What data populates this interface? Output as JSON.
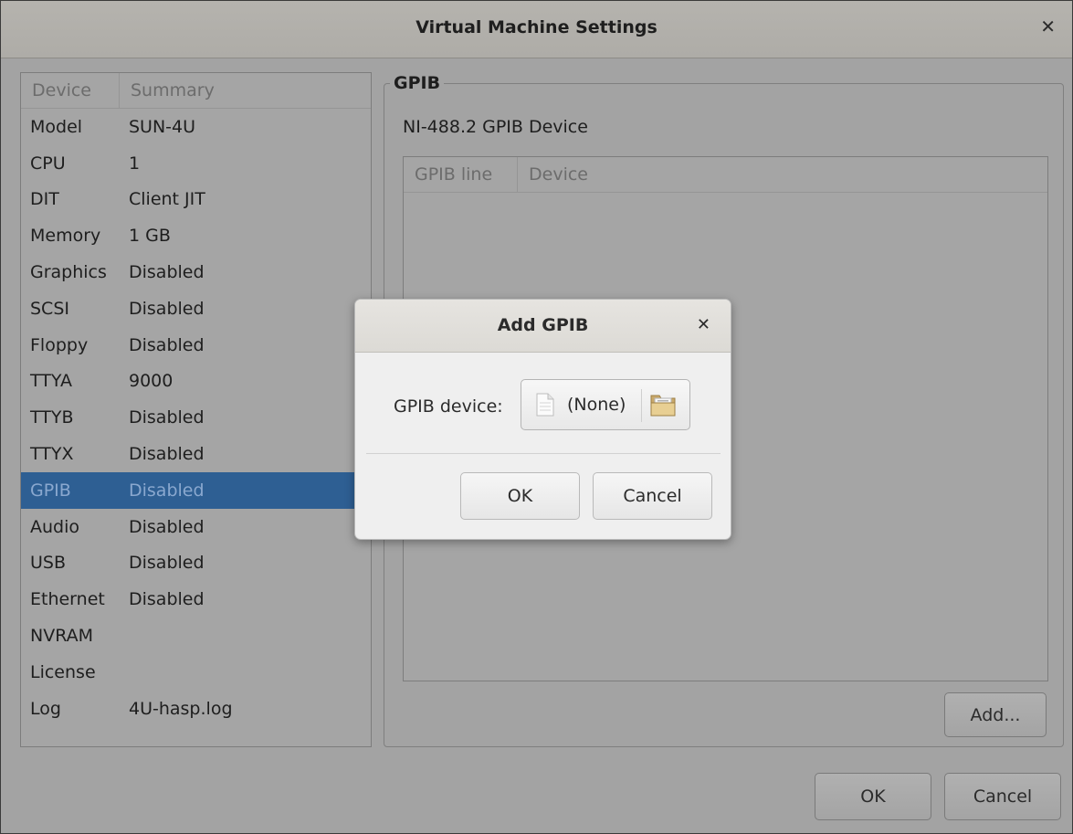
{
  "window": {
    "title": "Virtual Machine Settings"
  },
  "device_list": {
    "headers": {
      "device": "Device",
      "summary": "Summary"
    },
    "rows": [
      {
        "device": "Model",
        "summary": "SUN-4U"
      },
      {
        "device": "CPU",
        "summary": "1"
      },
      {
        "device": "DIT",
        "summary": "Client JIT"
      },
      {
        "device": "Memory",
        "summary": "1 GB"
      },
      {
        "device": "Graphics",
        "summary": "Disabled"
      },
      {
        "device": "SCSI",
        "summary": "Disabled"
      },
      {
        "device": "Floppy",
        "summary": "Disabled"
      },
      {
        "device": "TTYA",
        "summary": "9000"
      },
      {
        "device": "TTYB",
        "summary": "Disabled"
      },
      {
        "device": "TTYX",
        "summary": "Disabled"
      },
      {
        "device": "GPIB",
        "summary": "Disabled",
        "selected": true
      },
      {
        "device": "Audio",
        "summary": "Disabled"
      },
      {
        "device": "USB",
        "summary": "Disabled"
      },
      {
        "device": "Ethernet",
        "summary": "Disabled"
      },
      {
        "device": "NVRAM",
        "summary": ""
      },
      {
        "device": "License",
        "summary": ""
      },
      {
        "device": "Log",
        "summary": "4U-hasp.log"
      }
    ]
  },
  "gpib_panel": {
    "legend": "GPIB",
    "description": "NI-488.2 GPIB Device",
    "table_headers": {
      "line": "GPIB line",
      "device": "Device"
    },
    "add_label": "Add..."
  },
  "footer": {
    "ok_label": "OK",
    "cancel_label": "Cancel"
  },
  "modal": {
    "title": "Add GPIB",
    "field_label": "GPIB device:",
    "file_value": "(None)",
    "ok_label": "OK",
    "cancel_label": "Cancel"
  },
  "colors": {
    "selection": "#2e5f93",
    "dim_overlay": "#a3a3a3"
  },
  "icons": {
    "close": "close-icon",
    "document": "document-icon",
    "folder": "folder-icon"
  }
}
